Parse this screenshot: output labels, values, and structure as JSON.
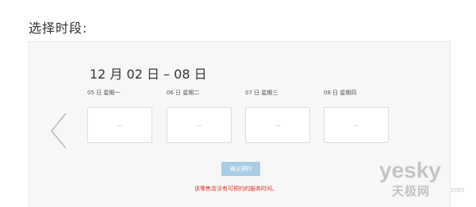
{
  "heading": "选择时段:",
  "date_range": "12 月 02 日 – 08 日",
  "days": [
    {
      "label": "05 日 星期一",
      "slot": "—"
    },
    {
      "label": "06 日 星期二",
      "slot": "—"
    },
    {
      "label": "07 日 星期三",
      "slot": "—"
    },
    {
      "label": "08 日 星期四",
      "slot": "—"
    }
  ],
  "confirm_label": "确认预约",
  "notice": "该零售店没有可预约的服务时间。",
  "watermark": {
    "latin": "yesky",
    "chinese": "天极网",
    "suffix": ".com"
  },
  "colors": {
    "confirm_button": "#a9cde6",
    "notice_text": "#e0342c",
    "panel_bg": "#f7f7f7"
  },
  "icons": {
    "prev": "chevron-left-icon"
  }
}
